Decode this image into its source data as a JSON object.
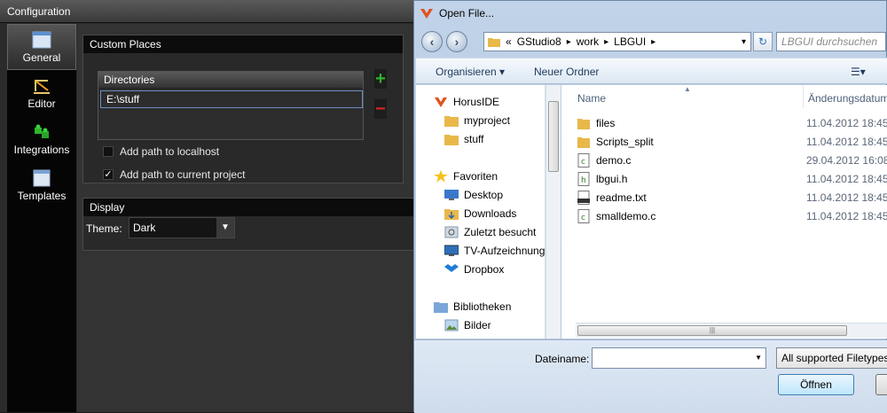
{
  "config": {
    "title": "Configuration",
    "sidebar": [
      {
        "label": "General",
        "icon": "window-icon"
      },
      {
        "label": "Editor",
        "icon": "editor-icon"
      },
      {
        "label": "Integrations",
        "icon": "puzzle-icon"
      },
      {
        "label": "Templates",
        "icon": "template-icon"
      }
    ],
    "custom_places": {
      "title": "Custom Places",
      "column_header": "Directories",
      "directories": [
        "E:\\stuff"
      ],
      "add_label": "+",
      "remove_label": "−",
      "add_localhost": {
        "label": "Add path to localhost",
        "checked": false
      },
      "add_project": {
        "label": "Add path to current project",
        "checked": true
      }
    },
    "display": {
      "title": "Display",
      "theme_label": "Theme:",
      "theme_value": "Dark"
    }
  },
  "dialog": {
    "title": "Open File...",
    "back_glyph": "‹",
    "forward_glyph": "›",
    "breadcrumb": {
      "prefix": "«",
      "parts": [
        "GStudio8",
        "work",
        "LBGUI"
      ],
      "sep": "▸",
      "end": "▸",
      "drop": "▾"
    },
    "refresh_glyph": "↻",
    "search_placeholder": "LBGUI durchsuchen",
    "commands": {
      "organize": "Organisieren ▾",
      "new_folder": "Neuer Ordner",
      "view": "☰▾"
    },
    "nav": {
      "horuside": "HorusIDE",
      "myproject": "myproject",
      "stuff": "stuff",
      "favorites": "Favoriten",
      "desktop": "Desktop",
      "downloads": "Downloads",
      "recent": "Zuletzt besucht",
      "tv": "TV-Aufzeichnungen",
      "dropbox": "Dropbox",
      "libraries": "Bibliotheken",
      "pictures": "Bilder"
    },
    "columns": {
      "name": "Name",
      "date": "Änderungsdatum",
      "sort": "▲"
    },
    "files": [
      {
        "name": "files",
        "date": "11.04.2012 18:45",
        "type": "folder"
      },
      {
        "name": "Scripts_split",
        "date": "11.04.2012 18:45",
        "type": "folder"
      },
      {
        "name": "demo.c",
        "date": "29.04.2012 16:08",
        "type": "c"
      },
      {
        "name": "lbgui.h",
        "date": "11.04.2012 18:45",
        "type": "h"
      },
      {
        "name": "readme.txt",
        "date": "11.04.2012 18:45",
        "type": "txt"
      },
      {
        "name": "smalldemo.c",
        "date": "11.04.2012 18:45",
        "type": "c"
      }
    ],
    "hscroll_grip": "|||",
    "filename_label": "Dateiname:",
    "filename_value": "",
    "filename_drop": "▼",
    "filter_value": "All supported Filetypes",
    "open_label": "Öffnen"
  },
  "colors": {
    "accent_green": "#2fb52f",
    "accent_red": "#d62424",
    "selection_border": "#6a8fbf",
    "folder": "#e8b84a"
  }
}
